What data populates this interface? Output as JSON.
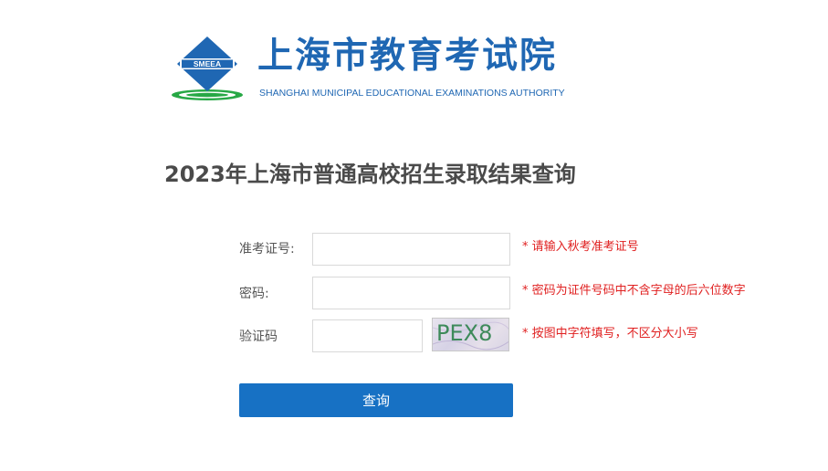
{
  "header": {
    "logo_badge_text": "SMEEA",
    "org_name": "上海市教育考试院",
    "org_name_en": "SHANGHAI MUNICIPAL EDUCATIONAL EXAMINATIONS AUTHORITY",
    "logo_icon": "smeea-diamond-logo-icon"
  },
  "page": {
    "title": "2023年上海市普通高校招生录取结果查询"
  },
  "form": {
    "exam_id": {
      "label": "准考证号:",
      "value": "",
      "placeholder": "",
      "hint": "* 请输入秋考准考证号"
    },
    "password": {
      "label": "密码:",
      "value": "",
      "placeholder": "",
      "hint": "* 密码为证件号码中不含字母的后六位数字"
    },
    "captcha": {
      "label": "验证码",
      "value": "",
      "placeholder": "",
      "image_text": "PEX8",
      "hint": "* 按图中字符填写，不区分大小写"
    },
    "submit_label": "查询"
  },
  "colors": {
    "brand_blue": "#1f67b3",
    "button_blue": "#1771c4",
    "hint_red": "#e02020",
    "logo_green": "#27a845"
  }
}
